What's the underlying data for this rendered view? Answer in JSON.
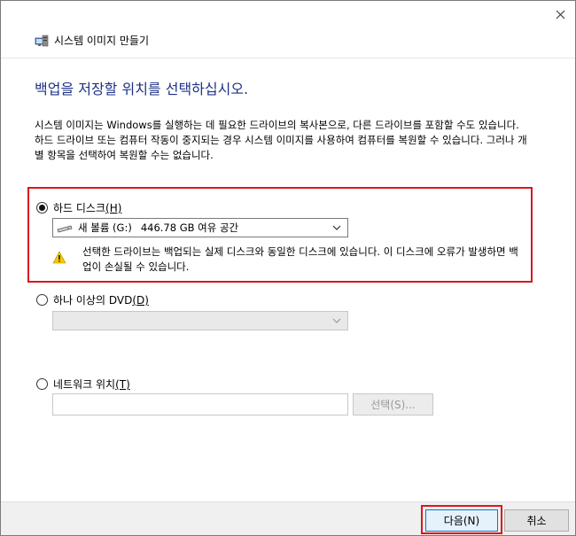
{
  "window": {
    "title": "시스템 이미지 만들기"
  },
  "page": {
    "heading": "백업을 저장할 위치를 선택하십시오.",
    "description": "시스템 이미지는 Windows를 실행하는 데 필요한 드라이브의 복사본으로, 다른 드라이브를 포함할 수도 있습니다. 하드 드라이브 또는 컴퓨터 작동이 중지되는 경우 시스템 이미지를 사용하여 컴퓨터를 복원할 수 있습니다. 그러나 개별 항목을 선택하여 복원할 수는 없습니다."
  },
  "options": {
    "hard_disk": {
      "label": "하드 디스크",
      "accesskey": "(H)",
      "selected": true,
      "drive_select": {
        "name": "새 볼륨 (G:)",
        "free": "446.78 GB 여유 공간"
      },
      "warning": "선택한 드라이브는 백업되는 실제 디스크와 동일한 디스크에 있습니다. 이 디스크에 오류가 발생하면 백업이 손실될 수 있습니다."
    },
    "dvd": {
      "label": "하나 이상의 DVD",
      "accesskey": "(D)",
      "selected": false
    },
    "network": {
      "label": "네트워크 위치",
      "accesskey": "(T)",
      "selected": false,
      "path_value": "",
      "select_button": "선택(S)..."
    }
  },
  "footer": {
    "next_button": "다음(N)",
    "cancel_button": "취소"
  },
  "colors": {
    "heading": "#1e3287",
    "highlight_box": "#d9181e"
  }
}
